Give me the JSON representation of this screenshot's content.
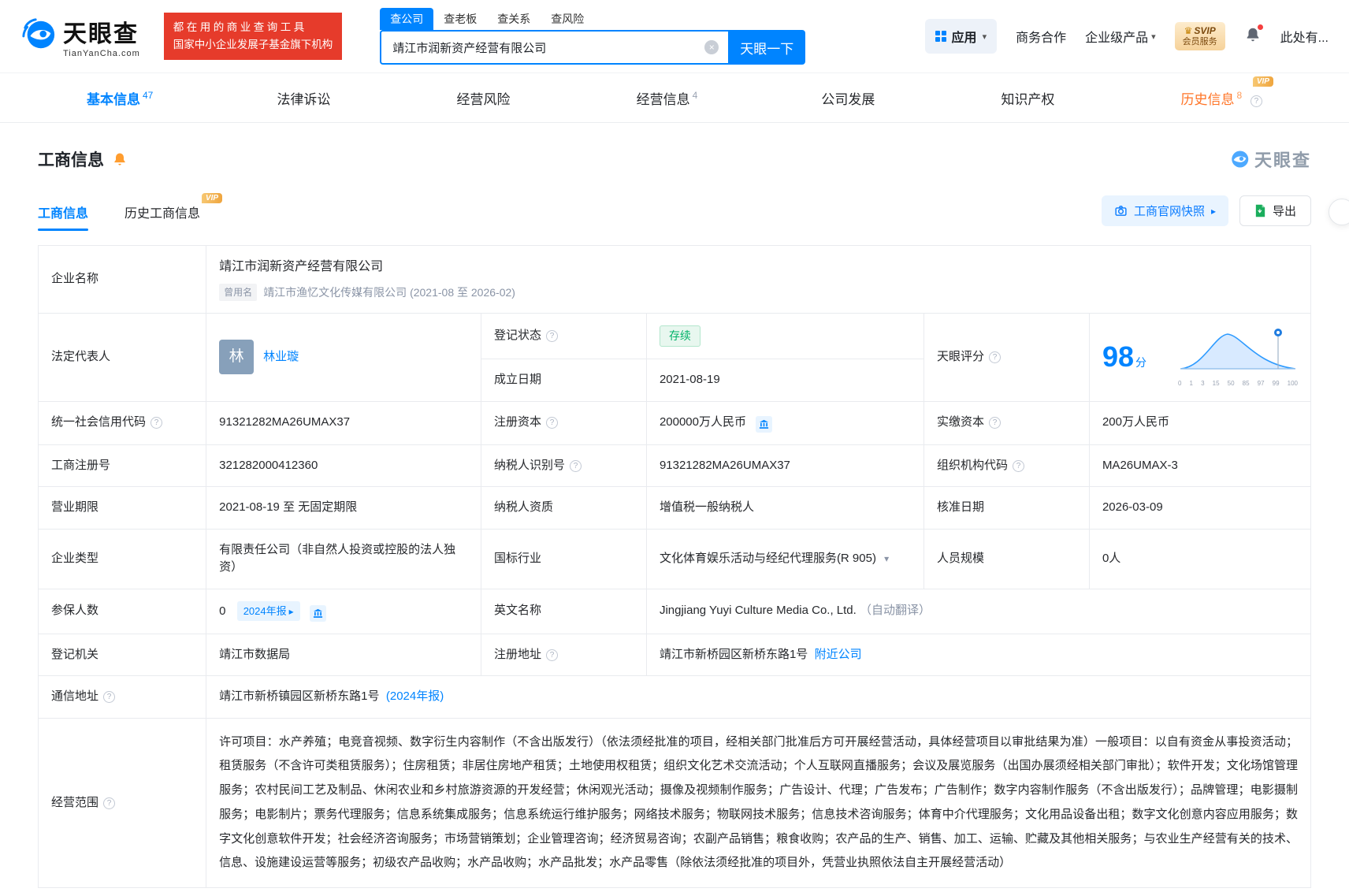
{
  "header": {
    "logo": {
      "title": "天眼查",
      "subtitle": "TianYanCha.com"
    },
    "banner": {
      "line1": "都在用的商业查询工具",
      "line2": "国家中小企业发展子基金旗下机构"
    },
    "search": {
      "tabs": [
        {
          "label": "查公司"
        },
        {
          "label": "查老板"
        },
        {
          "label": "查关系"
        },
        {
          "label": "查风险"
        }
      ],
      "value": "靖江市润新资产经营有限公司",
      "button_label": "天眼一下"
    },
    "apps_label": "应用",
    "biz_label": "商务合作",
    "enterprise_label": "企业级产品",
    "svip_line1": "SVIP",
    "svip_line2": "会员服务",
    "more_label": "此处有..."
  },
  "nav": {
    "vip_tag": "VIP",
    "tabs": [
      {
        "label": "基本信息",
        "count": "47"
      },
      {
        "label": "法律诉讼",
        "count": ""
      },
      {
        "label": "经营风险",
        "count": ""
      },
      {
        "label": "经营信息",
        "count": "4"
      },
      {
        "label": "公司发展",
        "count": ""
      },
      {
        "label": "知识产权",
        "count": ""
      },
      {
        "label": "历史信息",
        "count": "8"
      }
    ]
  },
  "section": {
    "title": "工商信息",
    "watermark": "天眼查",
    "tab_current": "工商信息",
    "tab_history": "历史工商信息",
    "vip_tag": "VIP",
    "snapshot_label": "工商官网快照",
    "export_label": "导出"
  },
  "fields": {
    "company_name": {
      "label": "企业名称",
      "value": "靖江市润新资产经营有限公司"
    },
    "former_name": {
      "tag": "曾用名",
      "value": "靖江市渔忆文化传媒有限公司 (2021-08 至 2026-02)"
    },
    "legal_rep": {
      "label": "法定代表人",
      "avatar": "林",
      "name": "林业璇"
    },
    "reg_status": {
      "label": "登记状态",
      "value": "存续"
    },
    "establish_date": {
      "label": "成立日期",
      "value": "2021-08-19"
    },
    "score": {
      "label": "天眼评分",
      "value": "98",
      "unit": "分",
      "axis": [
        "0",
        "1",
        "3",
        "15",
        "50",
        "85",
        "97",
        "99",
        "100"
      ]
    },
    "credit_code": {
      "label": "统一社会信用代码",
      "value": "91321282MA26UMAX37"
    },
    "reg_capital": {
      "label": "注册资本",
      "value": "200000万人民币"
    },
    "paid_capital": {
      "label": "实缴资本",
      "value": "200万人民币"
    },
    "reg_number": {
      "label": "工商注册号",
      "value": "321282000412360"
    },
    "taxpayer_id": {
      "label": "纳税人识别号",
      "value": "91321282MA26UMAX37"
    },
    "org_code": {
      "label": "组织机构代码",
      "value": "MA26UMAX-3"
    },
    "business_term": {
      "label": "营业期限",
      "value": "2021-08-19 至 无固定期限"
    },
    "taxpayer_quality": {
      "label": "纳税人资质",
      "value": "增值税一般纳税人"
    },
    "approval_date": {
      "label": "核准日期",
      "value": "2026-03-09"
    },
    "company_type": {
      "label": "企业类型",
      "value": "有限责任公司（非自然人投资或控股的法人独资）"
    },
    "industry": {
      "label": "国标行业",
      "value": "文化体育娱乐活动与经纪代理服务(R 905)"
    },
    "staff_size": {
      "label": "人员规模",
      "value": "0人"
    },
    "insured_count": {
      "label": "参保人数",
      "value": "0",
      "report_chip": "2024年报"
    },
    "english_name": {
      "label": "英文名称",
      "value": "Jingjiang Yuyi Culture Media Co., Ltd.",
      "note": "（自动翻译）"
    },
    "reg_authority": {
      "label": "登记机关",
      "value": "靖江市数据局"
    },
    "reg_address": {
      "label": "注册地址",
      "value": "靖江市新桥园区新桥东路1号",
      "link": "附近公司"
    },
    "mail_address": {
      "label": "通信地址",
      "value": "靖江市新桥镇园区新桥东路1号",
      "link": "(2024年报)"
    },
    "business_scope": {
      "label": "经营范围",
      "value": "许可项目：水产养殖；电竞音视频、数字衍生内容制作（不含出版发行）（依法须经批准的项目，经相关部门批准后方可开展经营活动，具体经营项目以审批结果为准）一般项目：以自有资金从事投资活动；租赁服务（不含许可类租赁服务）；住房租赁；非居住房地产租赁；土地使用权租赁；组织文化艺术交流活动；个人互联网直播服务；会议及展览服务（出国办展须经相关部门审批）；软件开发；文化场馆管理服务；农村民间工艺及制品、休闲农业和乡村旅游资源的开发经营；休闲观光活动；摄像及视频制作服务；广告设计、代理；广告发布；广告制作；数字内容制作服务（不含出版发行）；品牌管理；电影摄制服务；电影制片；票务代理服务；信息系统集成服务；信息系统运行维护服务；网络技术服务；物联网技术服务；信息技术咨询服务；体育中介代理服务；文化用品设备出租；数字文化创意内容应用服务；数字文化创意软件开发；社会经济咨询服务；市场营销策划；企业管理咨询；经济贸易咨询；农副产品销售；粮食收购；农产品的生产、销售、加工、运输、贮藏及其他相关服务；与农业生产经营有关的技术、信息、设施建设运营等服务；初级农产品收购；水产品收购；水产品批发；水产品零售（除依法须经批准的项目外，凭营业执照依法自主开展经营活动）"
    }
  }
}
